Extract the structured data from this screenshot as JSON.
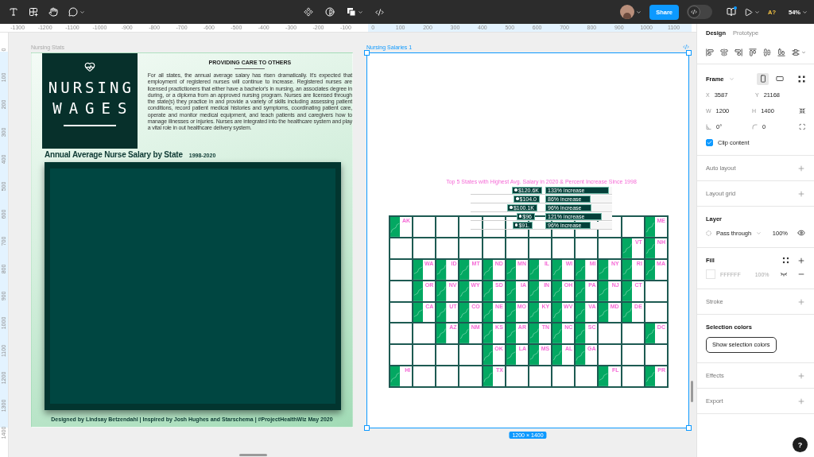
{
  "toolbar": {
    "share": "Share",
    "dev_mode": {
      "on": false
    },
    "font_warning": "A?",
    "zoom": "54%"
  },
  "ruler": {
    "x_labels": [
      "-1300",
      "-1200",
      "-1100",
      "-1000",
      "-900",
      "-800",
      "-700",
      "-600",
      "-500",
      "-400",
      "-300",
      "-200",
      "-100",
      "0",
      "100",
      "200",
      "300",
      "400",
      "500",
      "600",
      "700",
      "800",
      "900",
      "1000",
      "1100"
    ],
    "y_labels": [
      "0",
      "100",
      "200",
      "300",
      "400",
      "500",
      "600",
      "700",
      "800",
      "900",
      "1000",
      "1100",
      "1200",
      "1300",
      "1400"
    ]
  },
  "stats_frame": {
    "label": "Nursing Stats",
    "selected": false,
    "logo_lines": [
      "NURSING",
      "WAGES"
    ],
    "heading": "PROVIDING CARE TO OTHERS",
    "paragraph": "For all states, the annual average salary has risen dramatically. It's expected that employment of registered nurses will continue to increase. Registered nurses are licensed practictioners that either have a bachelor's in nursing, an associates degree in during, or a diploma from an approved nursing program. Nurses are licensed through the state(s) they practice in and provide a variety of skills including assessing patient conditions, record patient medical histories and symptoms, coordinating patient care, operate and monitor medical equipment, and teach patients and caregivers how to manage illnesses or injuries. Nurses are integrated into the healthcare system and play a vital role in out healthcare delivery system.",
    "chart_title": "Annual Average Nurse Salary by State",
    "chart_years": "1998-2020",
    "footer": "Designed by Lindsay Betzendahl  |  Inspired by Josh Hughes and Starschema  |  #ProjectHealthWiz May 2020"
  },
  "salaries_frame": {
    "label": "Nursing Salaries 1",
    "selected": true,
    "size": "1200 × 1400",
    "top5": {
      "title": "Top 5 States with Highest Avg. Salary in 2020 & Percent Increase Since 1998",
      "rows": [
        {
          "salary": {
            "text": "$120.6K"
          },
          "increase": {
            "text": "133% increase",
            "level": 0.95
          }
        },
        {
          "salary": {
            "text": "$104.0"
          },
          "increase": {
            "text": "86% increase",
            "level": 0.68
          }
        },
        {
          "salary": {
            "text": "$100.1K"
          },
          "increase": {
            "text": "96% increase",
            "level": 0.69
          }
        },
        {
          "salary": {
            "text": "$96"
          },
          "increase": {
            "text": "121% increase",
            "level": 0.85
          }
        },
        {
          "salary": {
            "text": "$91."
          },
          "increase": {
            "text": "96% increase",
            "level": 0.68
          }
        }
      ]
    },
    "grid_rows": [
      [
        "AK",
        null,
        null,
        null,
        null,
        null,
        null,
        null,
        null,
        null,
        null,
        "ME"
      ],
      [
        null,
        null,
        null,
        null,
        null,
        null,
        null,
        null,
        null,
        null,
        "VT",
        "NH"
      ],
      [
        null,
        "WA",
        "ID",
        "MT",
        "ND",
        "MN",
        "IL",
        "WI",
        "MI",
        "NY",
        "RI",
        "MA"
      ],
      [
        null,
        "OR",
        "NV",
        "WY",
        "SD",
        "IA",
        "IN",
        "OH",
        "PA",
        "NJ",
        "CT",
        null
      ],
      [
        null,
        "CA",
        "UT",
        "CO",
        "NE",
        "MO",
        "KY",
        "WV",
        "VA",
        "MD",
        "DE",
        null
      ],
      [
        null,
        null,
        "AZ",
        "NM",
        "KS",
        "AR",
        "TN",
        "NC",
        "SC",
        null,
        null,
        "DC"
      ],
      [
        null,
        null,
        null,
        null,
        "OK",
        "LA",
        "MS",
        "AL",
        "GA",
        null,
        null,
        null
      ],
      [
        "HI",
        null,
        null,
        null,
        "TX",
        null,
        null,
        null,
        null,
        "FL",
        null,
        "PR"
      ]
    ]
  },
  "panel": {
    "tabs": [
      {
        "label": "Design",
        "selected": true
      },
      {
        "label": "Prototype",
        "selected": false
      }
    ],
    "frame": {
      "title": "Frame",
      "orientations": [
        {
          "kind": "portrait",
          "selected": true
        },
        {
          "kind": "landscape",
          "selected": false
        }
      ],
      "rows": [
        [
          {
            "kind": "letter",
            "label": "X",
            "value": "3587"
          },
          {
            "kind": "letter",
            "label": "Y",
            "value": "21168"
          }
        ],
        [
          {
            "kind": "letter",
            "label": "W",
            "value": "1200"
          },
          {
            "kind": "letter",
            "label": "H",
            "value": "1400"
          }
        ],
        [
          {
            "kind": "angle",
            "value": "0°"
          },
          {
            "kind": "radius",
            "value": "0"
          }
        ]
      ],
      "clip": {
        "label": "Clip content",
        "checked": true
      }
    },
    "sections": [
      {
        "kind": "empty",
        "title": "Auto layout"
      },
      {
        "kind": "empty",
        "title": "Layout grid"
      },
      {
        "kind": "layer",
        "title": "Layer",
        "blend": "Pass through",
        "opacity": "100%"
      },
      {
        "kind": "fill",
        "title": "Fill",
        "hex": "FFFFFF",
        "opacity": "100%"
      },
      {
        "kind": "empty",
        "title": "Stroke"
      },
      {
        "kind": "selection",
        "title": "Selection colors",
        "button": "Show selection colors"
      },
      {
        "kind": "empty",
        "title": "Effects"
      },
      {
        "kind": "empty",
        "title": "Export"
      }
    ]
  },
  "help": "?"
}
